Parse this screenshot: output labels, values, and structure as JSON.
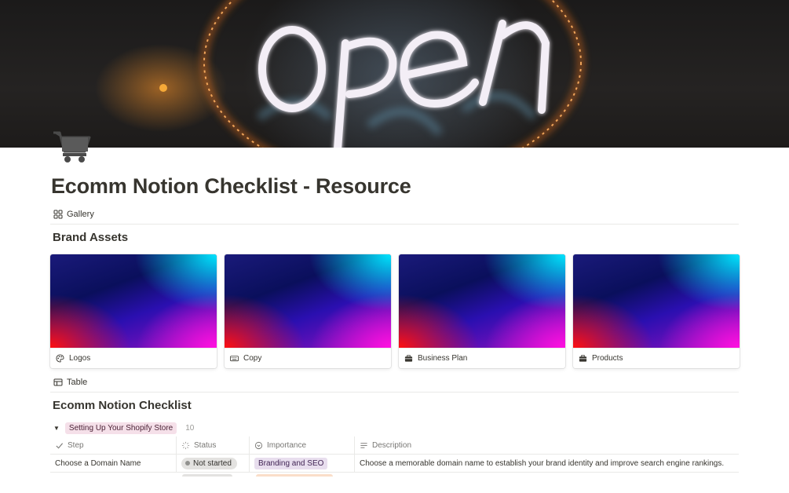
{
  "page": {
    "title": "Ecomm Notion Checklist - Resource",
    "icon": "shopping-cart-icon"
  },
  "cover": {
    "description_text": "OPEN",
    "neon_color": "#f3eef6",
    "glow_color": "#ff8a2a"
  },
  "gallery_view": {
    "tab_label": "Gallery",
    "icon": "gallery-grid-icon",
    "section_title": "Brand Assets",
    "cards": [
      {
        "label": "Logos",
        "icon": "palette-icon"
      },
      {
        "label": "Copy",
        "icon": "keyboard-icon"
      },
      {
        "label": "Business Plan",
        "icon": "briefcase-icon"
      },
      {
        "label": "Products",
        "icon": "briefcase-icon"
      }
    ]
  },
  "table_view": {
    "tab_label": "Table",
    "icon": "table-icon",
    "section_title": "Ecomm Notion Checklist",
    "group": {
      "label": "Setting Up Your Shopify Store",
      "count": "10",
      "color": "#f5e0e9"
    },
    "columns": [
      {
        "label": "Step",
        "icon": "check-icon"
      },
      {
        "label": "Status",
        "icon": "status-spinner-icon"
      },
      {
        "label": "Importance",
        "icon": "select-icon"
      },
      {
        "label": "Description",
        "icon": "text-lines-icon"
      }
    ],
    "rows": [
      {
        "step": "Choose a Domain Name",
        "status": "Not started",
        "importance": "Branding and SEO",
        "description": "Choose a memorable domain name to establish your brand identity and improve search engine rankings."
      }
    ]
  }
}
